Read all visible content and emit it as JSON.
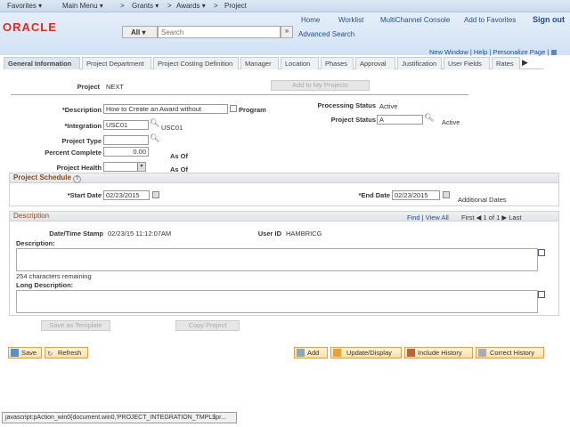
{
  "nav": {
    "favorites": "Favorites ▾",
    "main_menu": "Main Menu ▾",
    "grants": "Grants ▾",
    "awards": "Awards ▾",
    "project": "Project",
    "sep": ">"
  },
  "header": {
    "logo": "ORACLE",
    "home": "Home",
    "worklist": "Worklist",
    "multichannel": "MultiChannel Console",
    "add_favorites": "Add to Favorites",
    "sign_out": "Sign out",
    "search_scope": "All",
    "search_placeholder": "Search",
    "advanced_search": "Advanced Search"
  },
  "page_links": {
    "new_window": "New Window",
    "help": "Help",
    "personalize": "Personalize Page"
  },
  "tabs": [
    "General Information",
    "Project Department",
    "Project Costing Definition",
    "Manager",
    "Location",
    "Phases",
    "Approval",
    "Justification",
    "User Fields",
    "Rates"
  ],
  "form": {
    "project_label": "Project",
    "project_value": "NEXT",
    "add_my_projects": "Add to My Projects",
    "description_label": "*Description",
    "description_value": "How to Create an Award without",
    "program_label": "Program",
    "integration_label": "*Integration",
    "integration_value": "USC01",
    "integration_desc": "USC01",
    "project_type_label": "Project Type",
    "project_type_value": "",
    "percent_label": "Percent Complete",
    "percent_value": "0.00",
    "as_of_1": "As Of",
    "health_label": "Project Health",
    "health_value": "",
    "as_of_2": "As Of",
    "processing_status_label": "Processing Status",
    "processing_status_value": "Active",
    "project_status_label": "Project Status",
    "project_status_value": "A",
    "project_status_desc": "Active"
  },
  "schedule": {
    "title": "Project Schedule",
    "start_label": "*Start Date",
    "start_value": "02/23/2015",
    "end_label": "*End Date",
    "end_value": "02/23/2015",
    "additional_dates": "Additional Dates"
  },
  "description_section": {
    "title": "Description",
    "find": "Find",
    "view_all": "View All",
    "first": "First",
    "count": "1 of 1",
    "last": "Last",
    "timestamp_label": "Date/Time Stamp",
    "timestamp_value": "02/23/15 11:12:07AM",
    "userid_label": "User ID",
    "userid_value": "HAMBRICG",
    "desc_label": "Description:",
    "remaining": "254 characters remaining",
    "long_desc_label": "Long Description:"
  },
  "actions": {
    "save_template": "Save as Template",
    "copy_project": "Copy Project",
    "save": "Save",
    "refresh": "Refresh",
    "add": "Add",
    "update_display": "Update/Display",
    "include_history": "Include History",
    "correct_history": "Correct History"
  },
  "status_bar": "javascript:pAction_win0(document.win0,'PROJECT_INTEGRATION_TMPL$pr..."
}
